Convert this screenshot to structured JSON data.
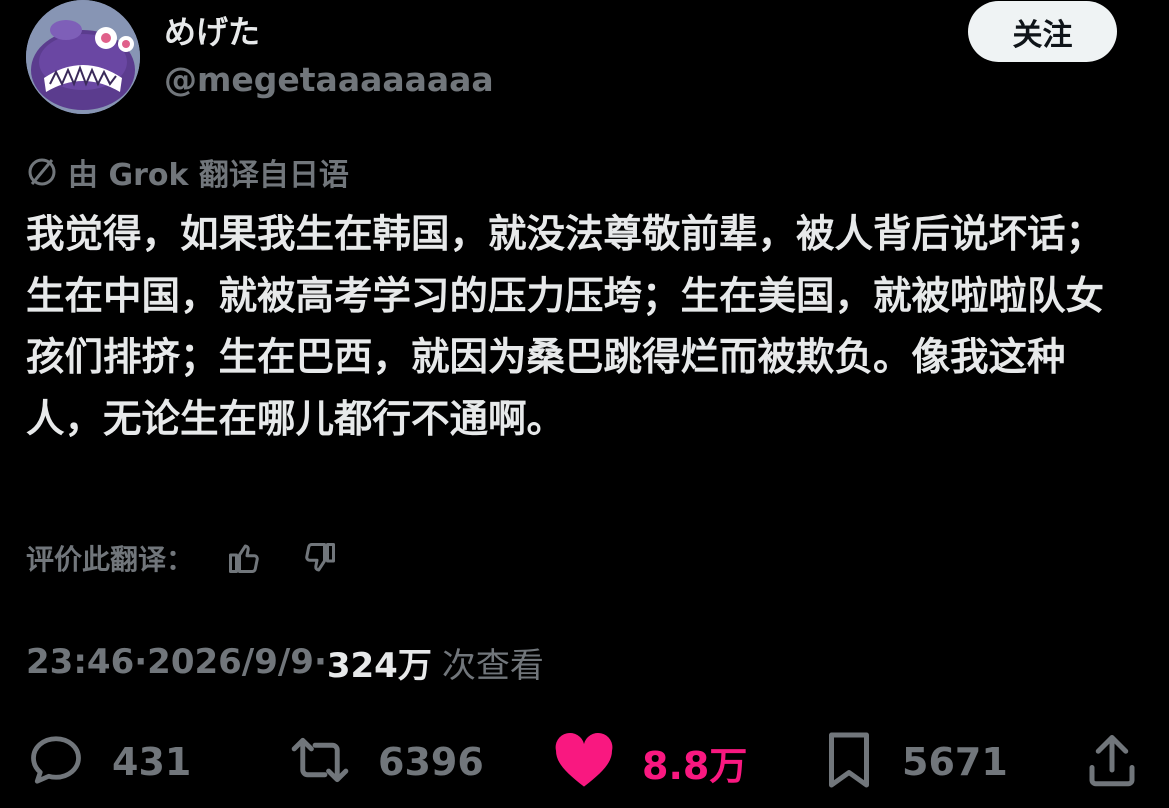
{
  "author": {
    "display_name": "めげた",
    "handle": "@megetaaaaaaaa",
    "avatar_icon": "cartoon-character-avatar"
  },
  "follow_button": {
    "label": "关注"
  },
  "translation": {
    "icon": "grok-slash-icon",
    "label": "由 Grok 翻译自日语"
  },
  "tweet": {
    "text": "我觉得，如果我生在韩国，就没法尊敬前辈，被人背后说坏话；生在中国，就被高考学习的压力压垮；生在美国，就被啦啦队女孩们排挤；生在巴西，就因为桑巴跳得烂而被欺负。像我这种人，无论生在哪儿都行不通啊。"
  },
  "rate_translation": {
    "label": "评价此翻译：",
    "thumbs_up_icon": "thumbs-up-icon",
    "thumbs_down_icon": "thumbs-down-icon"
  },
  "meta": {
    "time": "23:46",
    "separator": " · ",
    "date": "2026/9/9",
    "views_count": "324万",
    "views_label": "次查看"
  },
  "actions": {
    "reply_count": "431",
    "retweet_count": "6396",
    "like_count": "8.8万",
    "bookmark_count": "5671"
  },
  "colors": {
    "background": "#000000",
    "text": "#e7e9ea",
    "secondary": "#71767b",
    "like": "#f91880",
    "button_bg": "#eff3f4"
  }
}
